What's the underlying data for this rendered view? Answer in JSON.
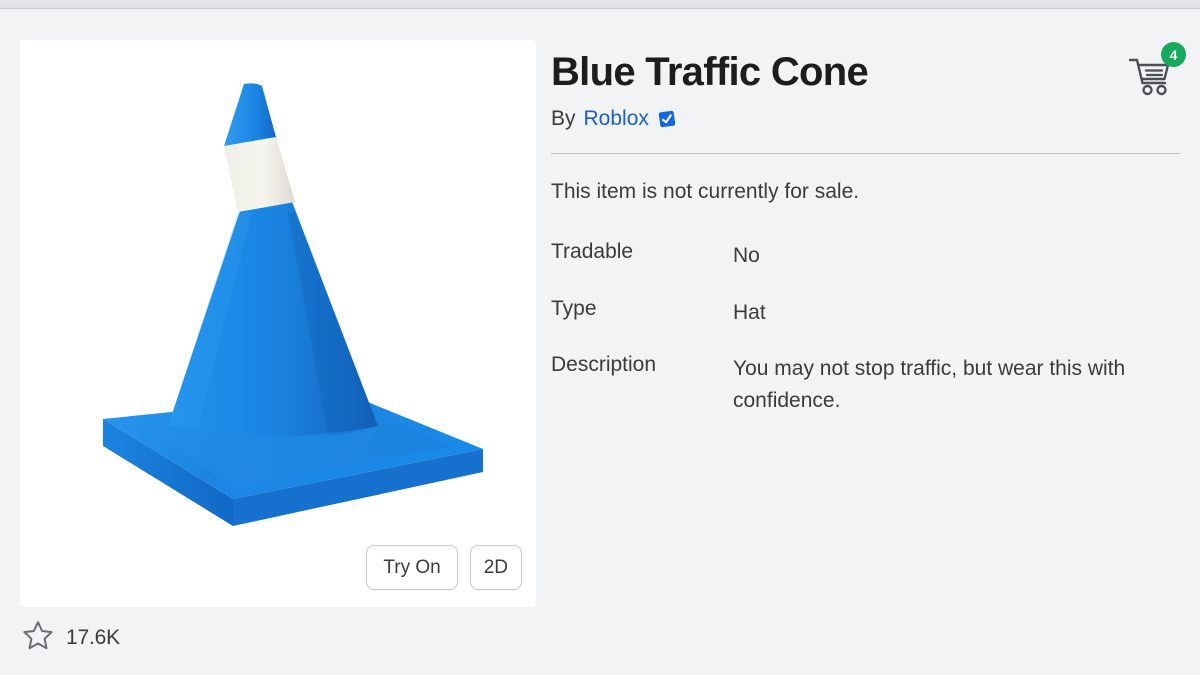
{
  "page": {
    "background_color": "#f2f3f4",
    "card_background": "#ffffff"
  },
  "item": {
    "title": "Blue Traffic Cone",
    "creator_prefix": "By",
    "creator_name": "Roblox",
    "verified_badge_label": "Verified",
    "sale_status": "This item is not currently for sale.",
    "favorites_count": "17.6K"
  },
  "specs": [
    {
      "label": "Tradable",
      "value": "No"
    },
    {
      "label": "Type",
      "value": "Hat"
    },
    {
      "label": "Description",
      "value": "You may not stop traffic, but wear this with confidence."
    }
  ],
  "viewer": {
    "try_on_label": "Try On",
    "two_d_label": "2D"
  },
  "cart": {
    "icon": "shopping-cart-icon",
    "badge_count": "4",
    "badge_color": "#17a95c"
  },
  "icons": {
    "favorite": "star-outline-icon",
    "verified": "verified-checkmark-icon"
  },
  "colors": {
    "accent_link": "#1d5ec9",
    "text_primary": "#393b3d",
    "title": "#1b1d1f",
    "cone_blue_light": "#1a8ae8",
    "cone_blue_dark": "#1264c2",
    "cone_stripe": "#f2f0e8",
    "divider": "#c2c5c8"
  },
  "thumbnail": {
    "subject": "blue-traffic-cone-3d-render"
  }
}
